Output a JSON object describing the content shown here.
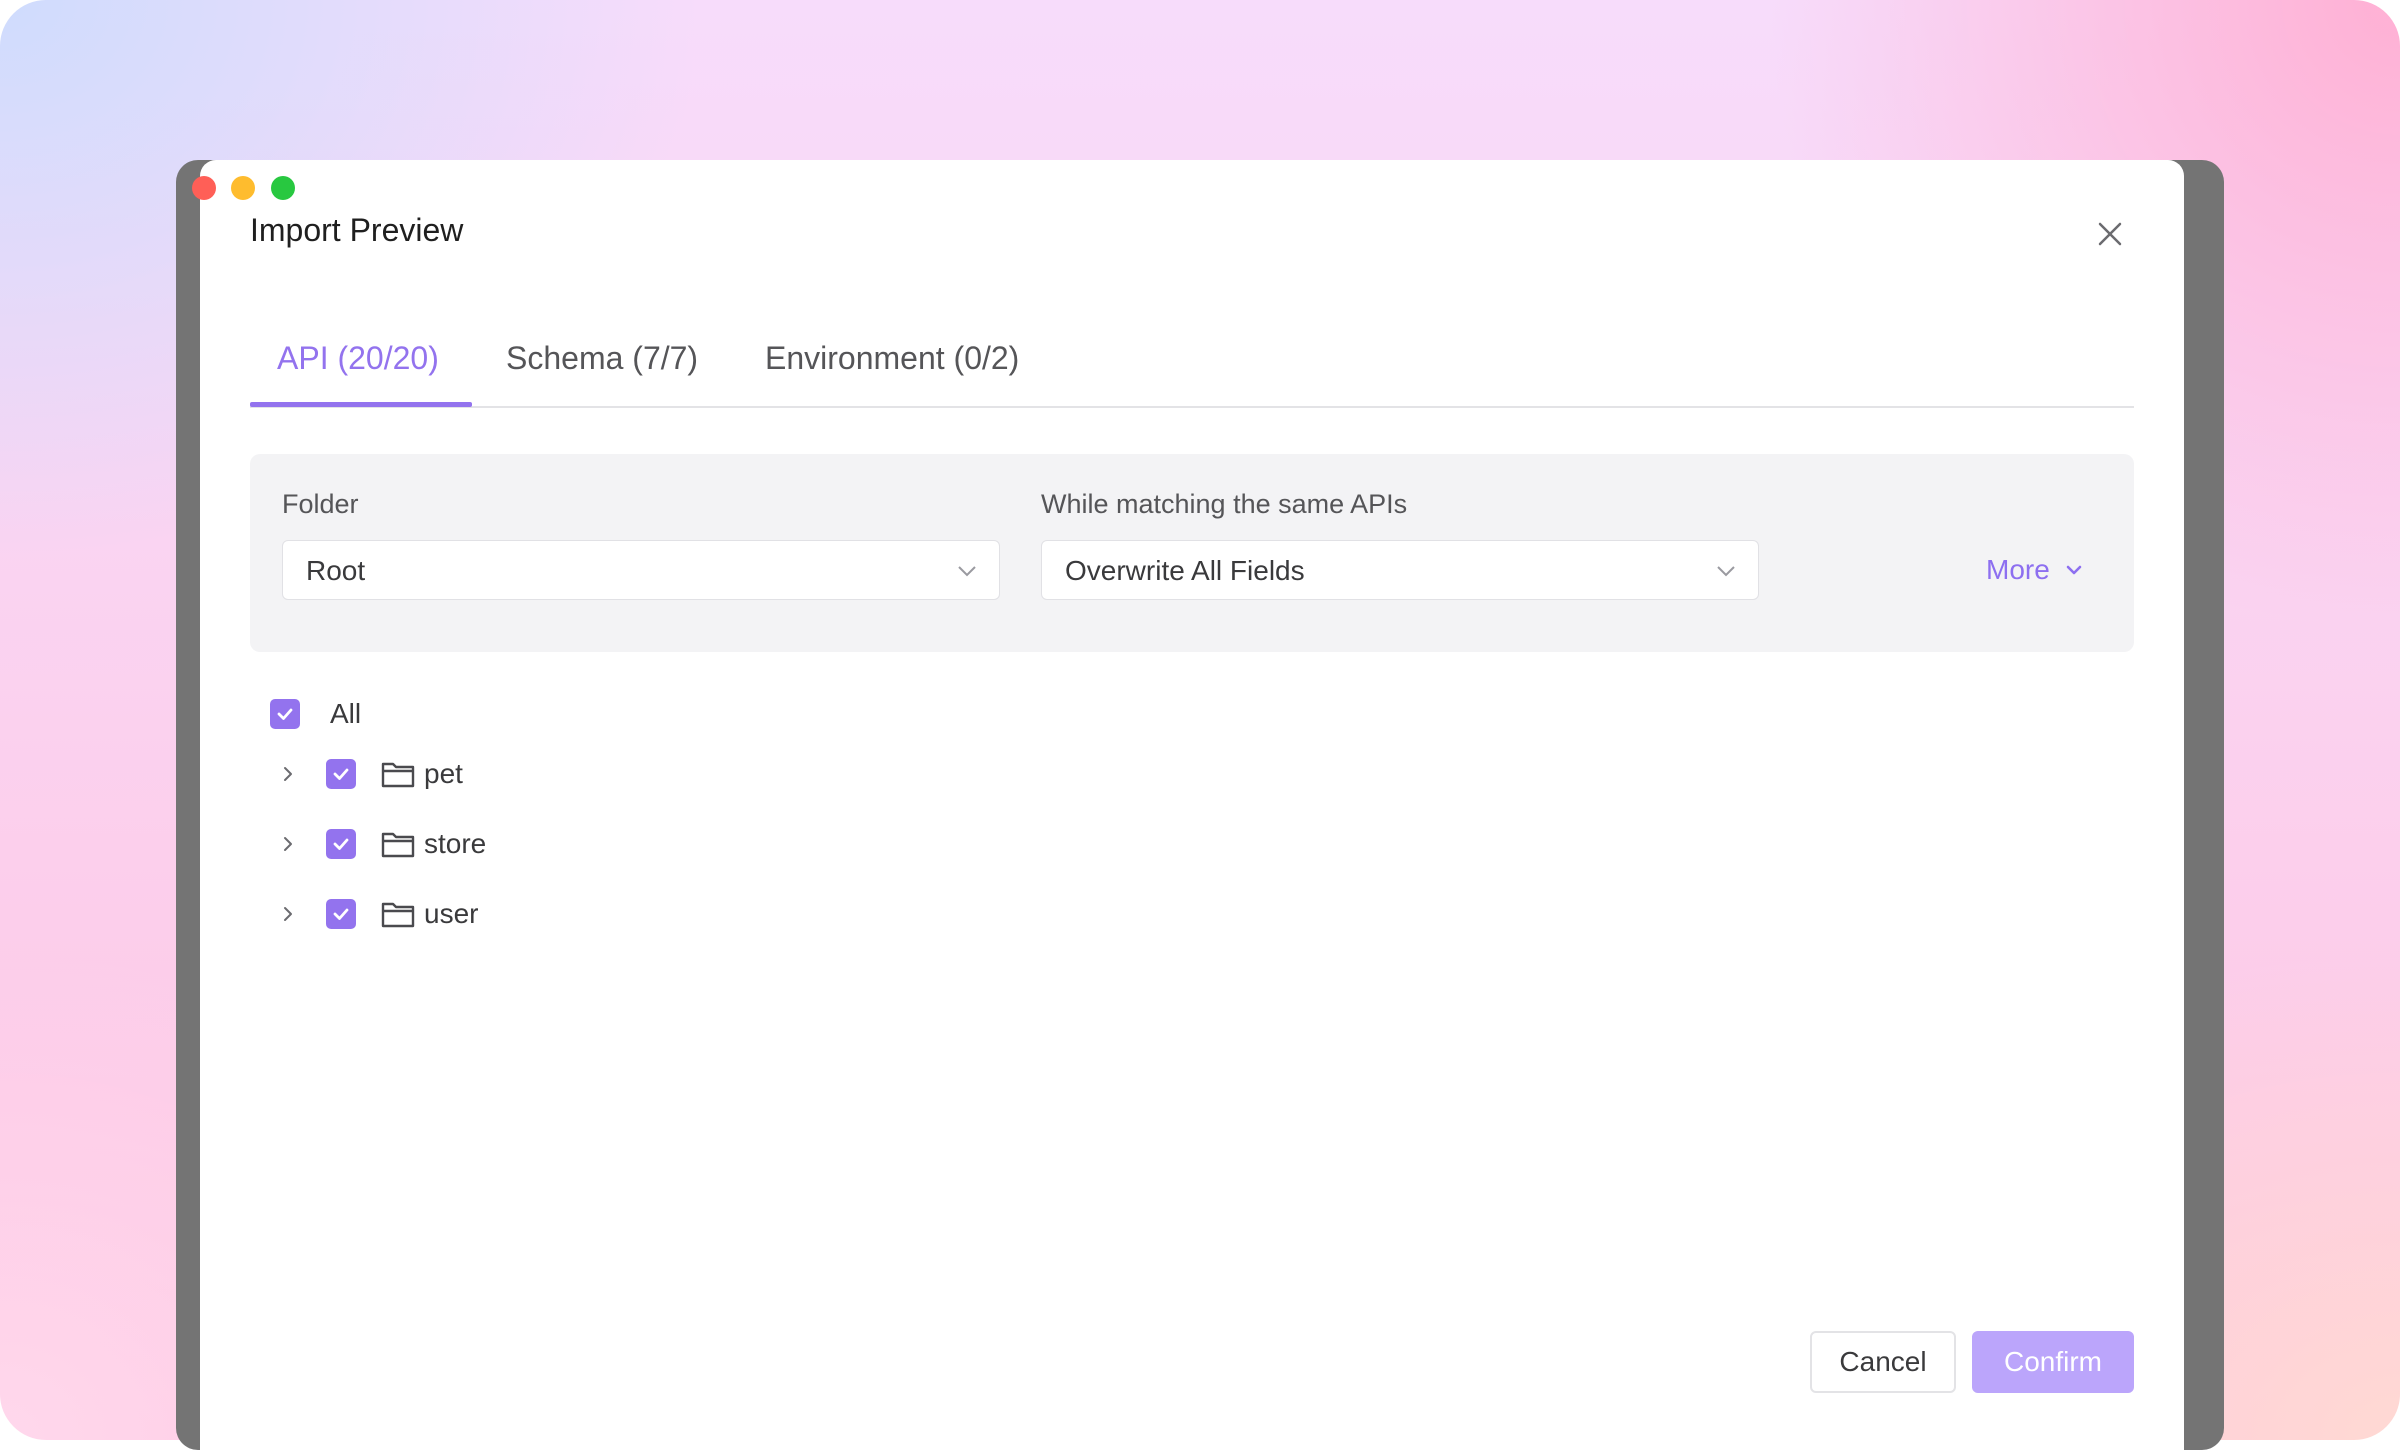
{
  "dialog": {
    "title": "Import Preview"
  },
  "tabs": [
    {
      "label": "API (20/20)"
    },
    {
      "label": "Schema (7/7)"
    },
    {
      "label": "Environment (0/2)"
    }
  ],
  "filters": {
    "folder": {
      "label": "Folder",
      "value": "Root"
    },
    "matching": {
      "label": "While matching the same APIs",
      "value": "Overwrite All Fields"
    },
    "more_label": "More"
  },
  "tree": {
    "all_label": "All",
    "items": [
      {
        "label": "pet"
      },
      {
        "label": "store"
      },
      {
        "label": "user"
      }
    ]
  },
  "footer": {
    "cancel_label": "Cancel",
    "confirm_label": "Confirm"
  },
  "colors": {
    "accent": "#9373ee",
    "confirm_bg": "#bba5fb"
  }
}
